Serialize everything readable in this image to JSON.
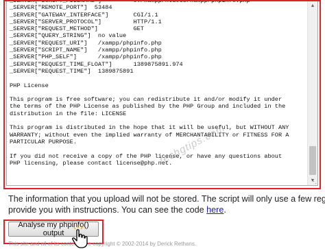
{
  "textarea": {
    "lines": [
      "_SERVER[\"SCRIPT_FILENAME\"]         C:/xampp/htdocs/xampp/phpinfo.php",
      "_SERVER[\"REMOTE_PORT\"]  53484",
      "_SERVER[\"GATEWAY_INTERFACE\"]       CGI/1.1",
      "_SERVER[\"SERVER_PROTOCOL\"]         HTTP/1.1",
      "_SERVER[\"REQUEST_METHOD\"]          GET",
      "_SERVER[\"QUERY_STRING\"]  no value",
      "_SERVER[\"REQUEST_URI\"]   /xampp/phpinfo.php",
      "_SERVER[\"SCRIPT_NAME\"]   /xampp/phpinfo.php",
      "_SERVER[\"PHP_SELF\"]      /xampp/phpinfo.php",
      "_SERVER[\"REQUEST_TIME_FLOAT\"]      1389875891.974",
      "_SERVER[\"REQUEST_TIME\"]  1389875891",
      "",
      "PHP License",
      "",
      "This program is free software; you can redistribute it and/or modify it under",
      "the terms of the PHP License as published by the PHP Group and included in the",
      "distribution in the file: LICENSE",
      "",
      "This program is distributed in the hope that it will be useful, but WITHOUT ANY",
      "WARRANTY; without even the implied warranty of MERCHANTABILITY or FITNESS FOR A",
      "PARTICULAR PURPOSE.",
      "",
      "If you did not receive a copy of the PHP license, or have any questions about",
      "PHP licensing, please contact license@php.net."
    ]
  },
  "watermark": "techgtips.com",
  "info": {
    "line1": "The information that you upload will not be stored. The script will only use a few regular expressions",
    "line2_prefix": "provide you with instructions. You can see the code ",
    "link": "here",
    "line2_suffix": "."
  },
  "button": {
    "label": "Analyse my phpinfo() output"
  },
  "footer": "This site and all of its contents are copyright © 2002-2014 by Derick Rethans.",
  "colors": {
    "highlight": "#d9222a",
    "link": "#1a1aa6"
  },
  "icons": {
    "cursor": "hand-pointer-icon",
    "scroll_up": "scroll-up-arrow-icon",
    "scroll_down": "scroll-down-arrow-icon",
    "resize": "resize-grip-icon"
  }
}
